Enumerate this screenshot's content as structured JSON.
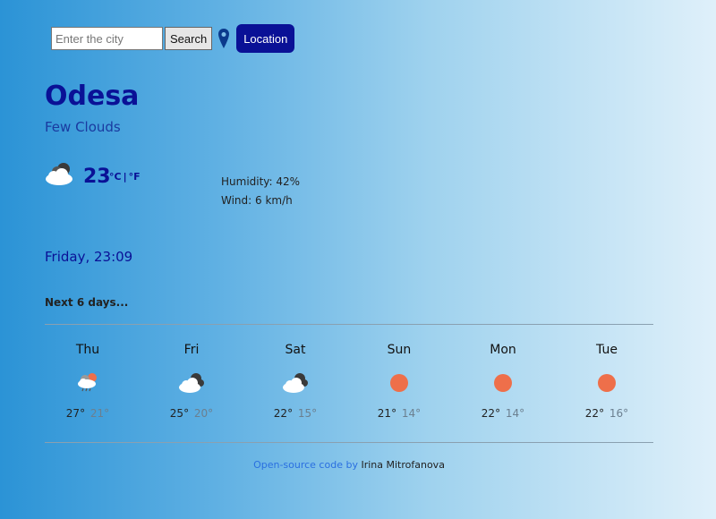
{
  "search": {
    "placeholder": "Enter the city",
    "button": "Search",
    "location_button": "Location"
  },
  "current": {
    "city": "Odesa",
    "description": "Few Clouds",
    "temperature": "23",
    "unit_c": "°C",
    "unit_sep": "|",
    "unit_f": "°F",
    "icon": "few-clouds-icon",
    "humidity": "Humidity: 42%",
    "wind": "Wind: 6 km/h",
    "datetime": "Friday, 23:09"
  },
  "forecast_heading": "Next 6 days...",
  "forecast": [
    {
      "day": "Thu",
      "max": "27°",
      "min": "21°",
      "icon": "rain-icon"
    },
    {
      "day": "Fri",
      "max": "25°",
      "min": "20°",
      "icon": "cloudy-icon"
    },
    {
      "day": "Sat",
      "max": "22°",
      "min": "15°",
      "icon": "cloudy-icon"
    },
    {
      "day": "Sun",
      "max": "21°",
      "min": "14°",
      "icon": "sun-icon"
    },
    {
      "day": "Mon",
      "max": "22°",
      "min": "14°",
      "icon": "sun-icon"
    },
    {
      "day": "Tue",
      "max": "22°",
      "min": "16°",
      "icon": "sun-icon"
    }
  ],
  "footer": {
    "link_text": "Open-source code",
    "by": "by",
    "author": "Irina Mitrofanova"
  },
  "colors": {
    "accent": "#0a1196",
    "sun": "#ee6f4a"
  }
}
